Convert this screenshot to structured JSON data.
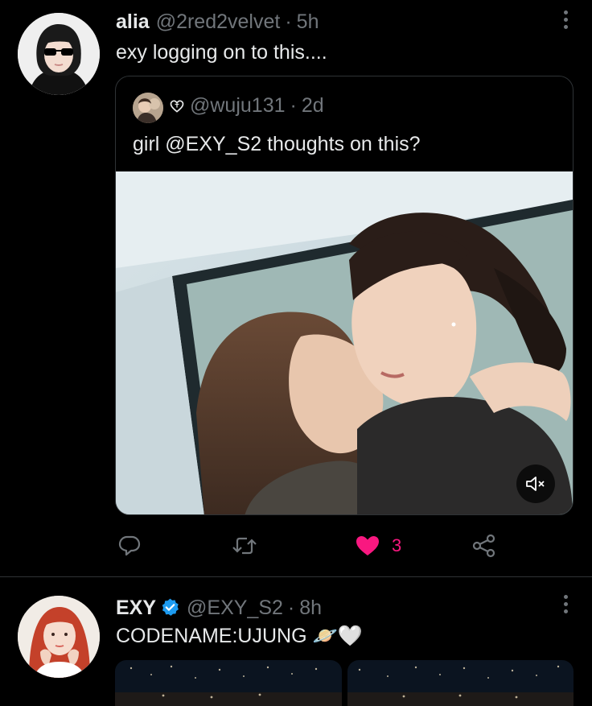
{
  "tweets": [
    {
      "name": "alia",
      "handle": "@2red2velvet",
      "separator": "·",
      "time": "5h",
      "text": "exy logging on to this....",
      "avatar_icon": "user-avatar-sunglasses",
      "quoted": {
        "handle": "@wuju131",
        "separator": "·",
        "time": "2d",
        "text": "girl @EXY_S2 thoughts on this?",
        "prefix_icon": "heart-outline-icon",
        "media_type": "video",
        "mute_icon": "speaker-muted-icon"
      },
      "actions": {
        "reply_icon": "reply-icon",
        "retweet_icon": "retweet-icon",
        "like_icon": "heart-filled-icon",
        "like_count": "3",
        "share_icon": "share-icon"
      }
    },
    {
      "name": "EXY",
      "verified": true,
      "handle": "@EXY_S2",
      "separator": "·",
      "time": "8h",
      "text": "CODENAME:UJUNG 🪐🤍",
      "avatar_icon": "user-avatar-redhair"
    }
  ],
  "colors": {
    "background": "#000000",
    "text_primary": "#e7e9ea",
    "text_secondary": "#71767b",
    "like_pink": "#f91880",
    "verified_blue": "#1d9bf0",
    "divider": "#2f3336"
  }
}
